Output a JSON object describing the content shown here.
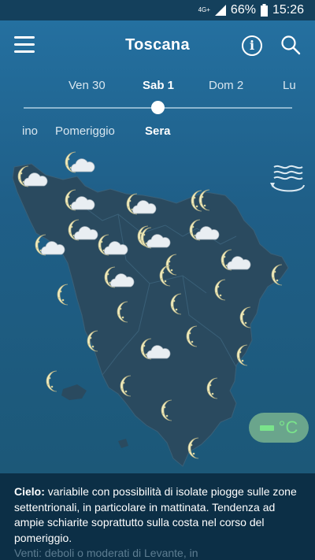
{
  "status_bar": {
    "network": "4G+",
    "battery": "66%",
    "time": "15:26"
  },
  "header": {
    "title": "Toscana"
  },
  "day_tabs": [
    {
      "label": "Ven 30",
      "active": false
    },
    {
      "label": "Sab 1",
      "active": true
    },
    {
      "label": "Dom 2",
      "active": false
    },
    {
      "label": "Lu",
      "active": false
    }
  ],
  "period_tabs": [
    {
      "label": "ino",
      "active": false
    },
    {
      "label": "Pomeriggio",
      "active": false
    },
    {
      "label": "Sera",
      "active": true
    }
  ],
  "unit_toggle": {
    "label": "°C"
  },
  "forecast": {
    "label": "Cielo:",
    "text": " variabile con possibilità di isolate piogge sulle zone settentrionali, in particolare in mattinata. Tendenza ad ampie schiarite soprattutto sulla costa nel corso del pomeriggio.",
    "next_line": "Venti: deboli o moderati di Levante, in"
  },
  "map_icons": [
    {
      "type": "moon-cloud"
    },
    {
      "type": "moon-cloud"
    },
    {
      "type": "moon-cloud"
    },
    {
      "type": "moon-cloud"
    },
    {
      "type": "moon-cloud"
    },
    {
      "type": "moon-cloud"
    },
    {
      "type": "moon"
    },
    {
      "type": "moon-cloud"
    },
    {
      "type": "moon-cloud"
    },
    {
      "type": "moon-cloud"
    },
    {
      "type": "moon-cloud"
    },
    {
      "type": "moon-cloud"
    },
    {
      "type": "moon"
    },
    {
      "type": "moon"
    },
    {
      "type": "moon"
    },
    {
      "type": "moon"
    },
    {
      "type": "moon"
    },
    {
      "type": "moon"
    },
    {
      "type": "moon-cloud"
    },
    {
      "type": "moon"
    },
    {
      "type": "moon"
    },
    {
      "type": "moon"
    },
    {
      "type": "moon"
    },
    {
      "type": "moon"
    },
    {
      "type": "moon"
    },
    {
      "type": "moon"
    },
    {
      "type": "moon"
    },
    {
      "type": "moon"
    },
    {
      "type": "moon"
    },
    {
      "type": "moon"
    },
    {
      "type": "moon"
    }
  ],
  "colors": {
    "sky": "#2470a0",
    "land": "#2a4a5f",
    "panel": "#0c2f46",
    "moon": "#f3efc0",
    "accent": "#7ae38b"
  }
}
